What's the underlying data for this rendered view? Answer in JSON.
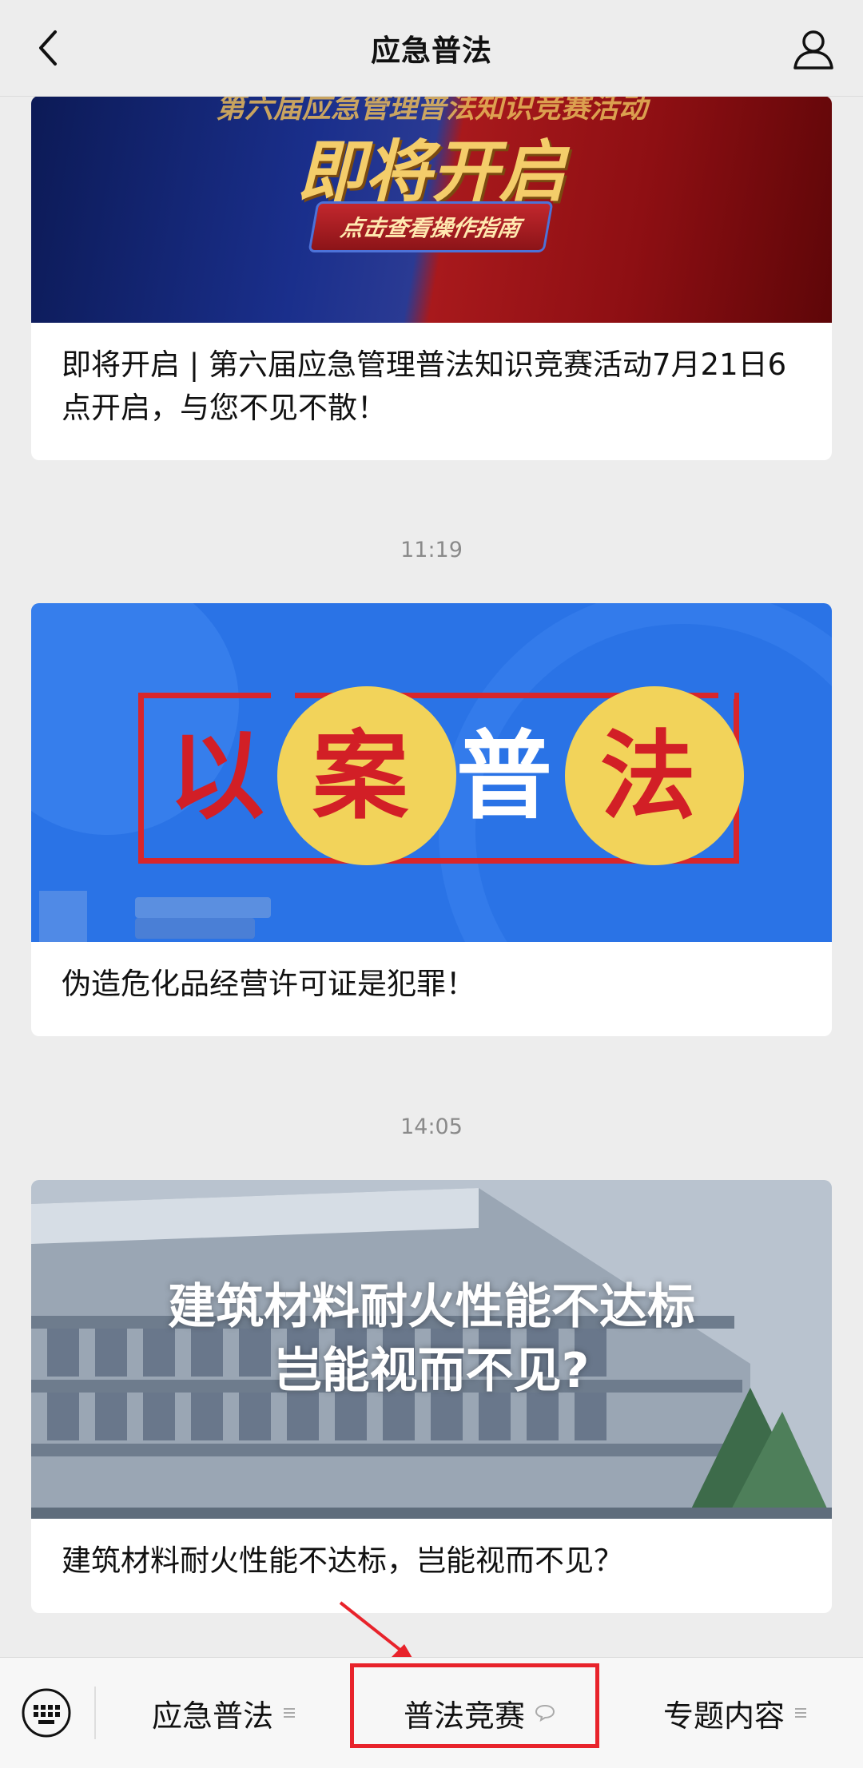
{
  "header": {
    "title": "应急普法",
    "back_icon": "chevron-left-icon",
    "profile_icon": "user-icon"
  },
  "feed": {
    "articles": [
      {
        "banner_top": "第六届应急管理普法知识竞赛活动",
        "banner_main": "即将开启",
        "banner_button": "点击查看操作指南",
        "title": "即将开启 | 第六届应急管理普法知识竞赛活动7月21日6点开启，与您不见不散！"
      },
      {
        "timestamp": "11:19",
        "banner_chars": [
          "以",
          "案",
          "普",
          "法"
        ],
        "title": "伪造危化品经营许可证是犯罪！"
      },
      {
        "timestamp": "14:05",
        "banner_line1": "建筑材料耐火性能不达标",
        "banner_line2": "岂能视而不见?",
        "title": "建筑材料耐火性能不达标，岂能视而不见？"
      }
    ]
  },
  "bottom_bar": {
    "keyboard_icon": "keyboard-icon",
    "menus": [
      {
        "label": "应急普法",
        "icon": "menu-lines-icon"
      },
      {
        "label": "普法竞赛",
        "icon": "speech-bubble-icon"
      },
      {
        "label": "专题内容",
        "icon": "menu-lines-icon"
      }
    ],
    "highlight_color": "#e8232b"
  }
}
